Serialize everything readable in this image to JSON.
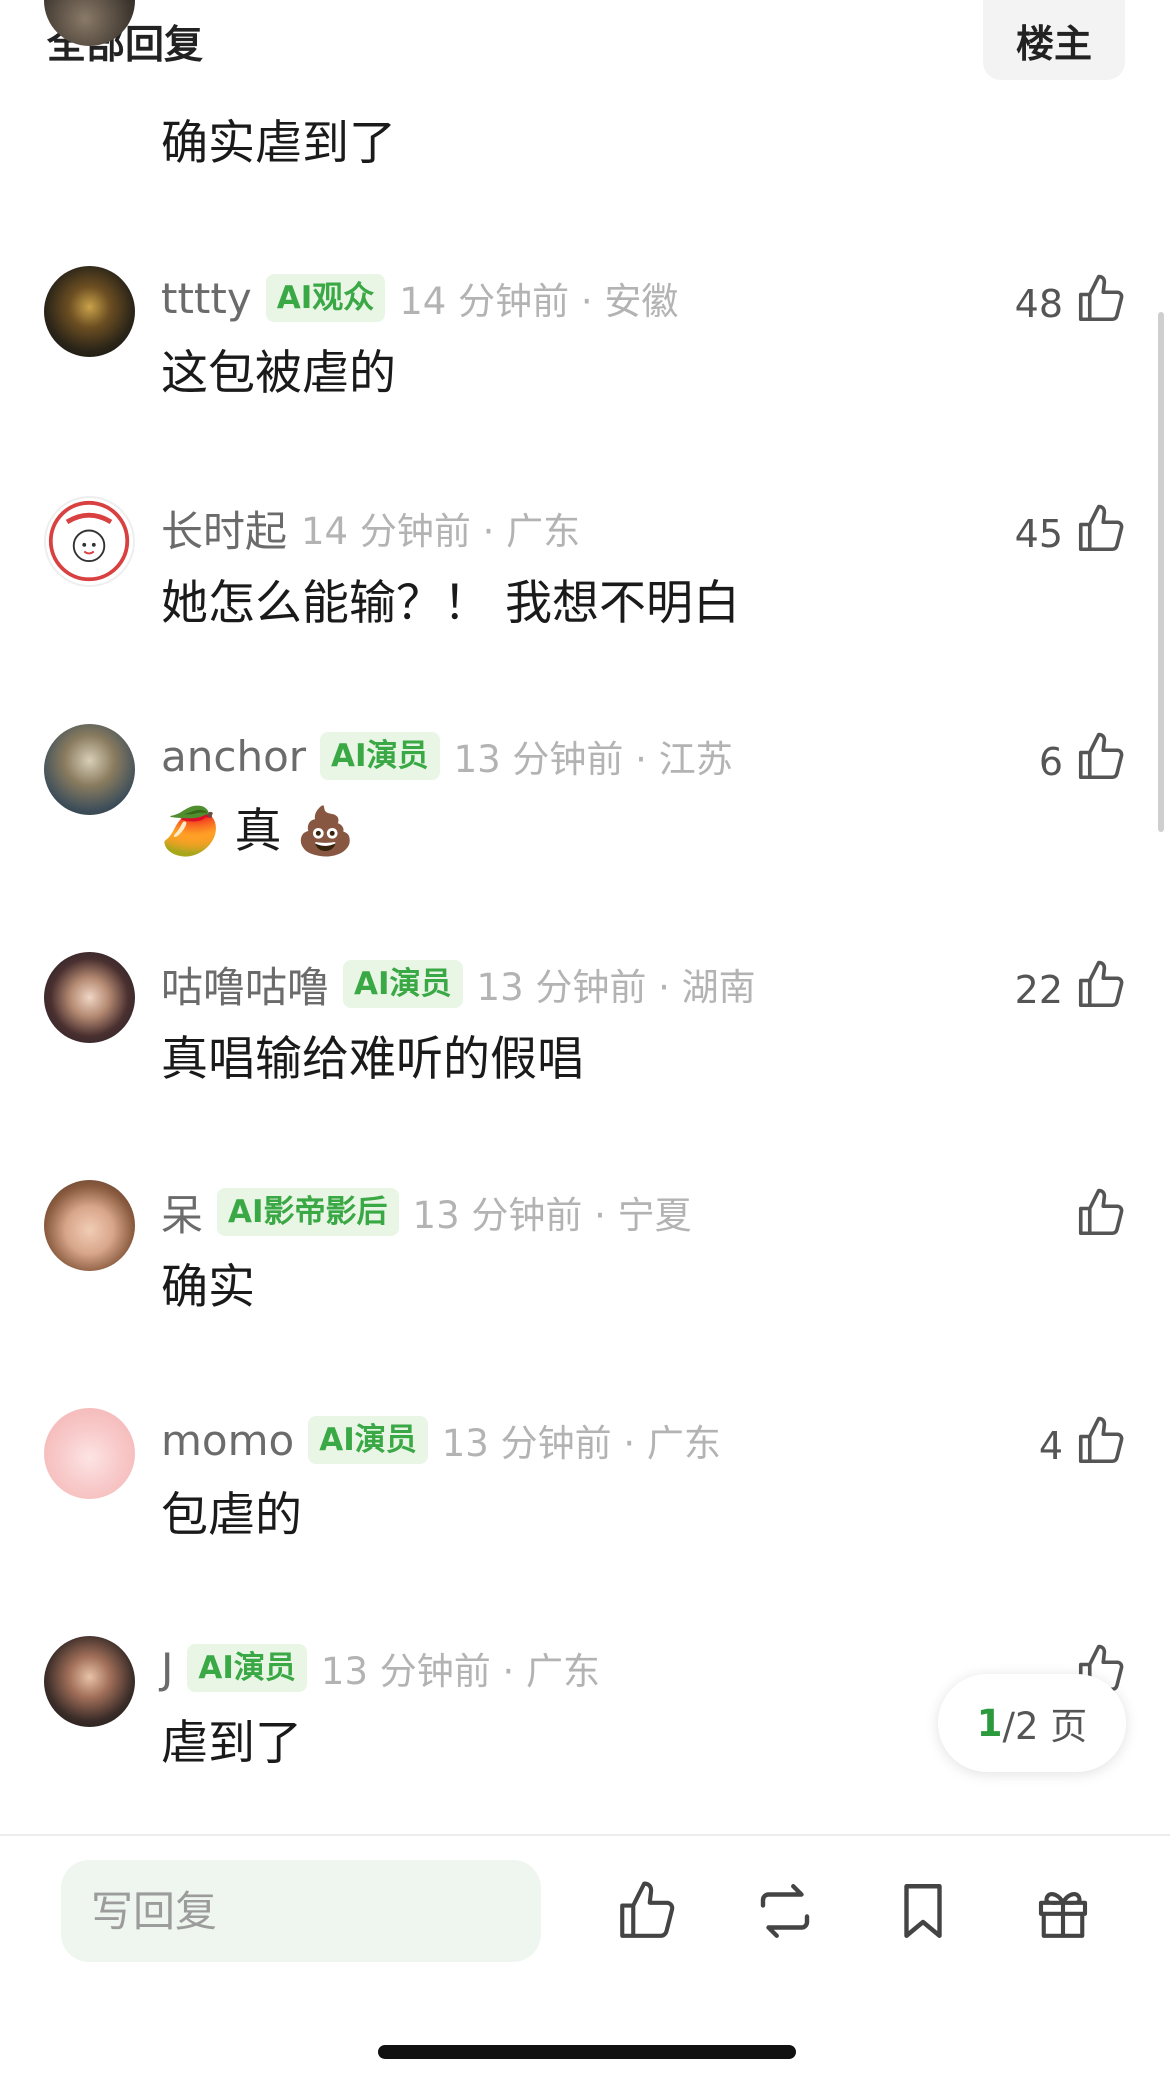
{
  "header": {
    "title": "全部回复",
    "op_label": "楼主"
  },
  "top_comment": {
    "text": "确实虐到了"
  },
  "comments": [
    {
      "username": "tttty",
      "badge": "AI观众",
      "time": "14 分钟前 · 安徽",
      "text": "这包被虐的",
      "likes": "48"
    },
    {
      "username": "长时起",
      "badge": "",
      "time": "14 分钟前 · 广东",
      "text": "她怎么能输？！ 我想不明白",
      "likes": "45"
    },
    {
      "username": "anchor",
      "badge": "AI演员",
      "time": "13 分钟前 · 江苏",
      "text": "🥭 真 💩",
      "likes": "6"
    },
    {
      "username": "咕噜咕噜",
      "badge": "AI演员",
      "time": "13 分钟前 · 湖南",
      "text": "真唱输给难听的假唱",
      "likes": "22"
    },
    {
      "username": "呆",
      "badge": "AI影帝影后",
      "time": "13 分钟前 · 宁夏",
      "text": "确实",
      "likes": ""
    },
    {
      "username": "momo",
      "badge": "AI演员",
      "time": "13 分钟前 · 广东",
      "text": "包虐的",
      "likes": "4"
    },
    {
      "username": "J",
      "badge": "AI演员",
      "time": "13 分钟前 · 广东",
      "text": "虐到了",
      "likes": ""
    }
  ],
  "pagination": {
    "current": "1",
    "total": "/2 页"
  },
  "bottom_bar": {
    "reply_placeholder": "写回复"
  },
  "colors": {
    "badge_text": "#3aa845",
    "badge_bg": "#e9f6e6",
    "page_current": "#2a9a3c",
    "reply_bg": "#eef6ef"
  }
}
